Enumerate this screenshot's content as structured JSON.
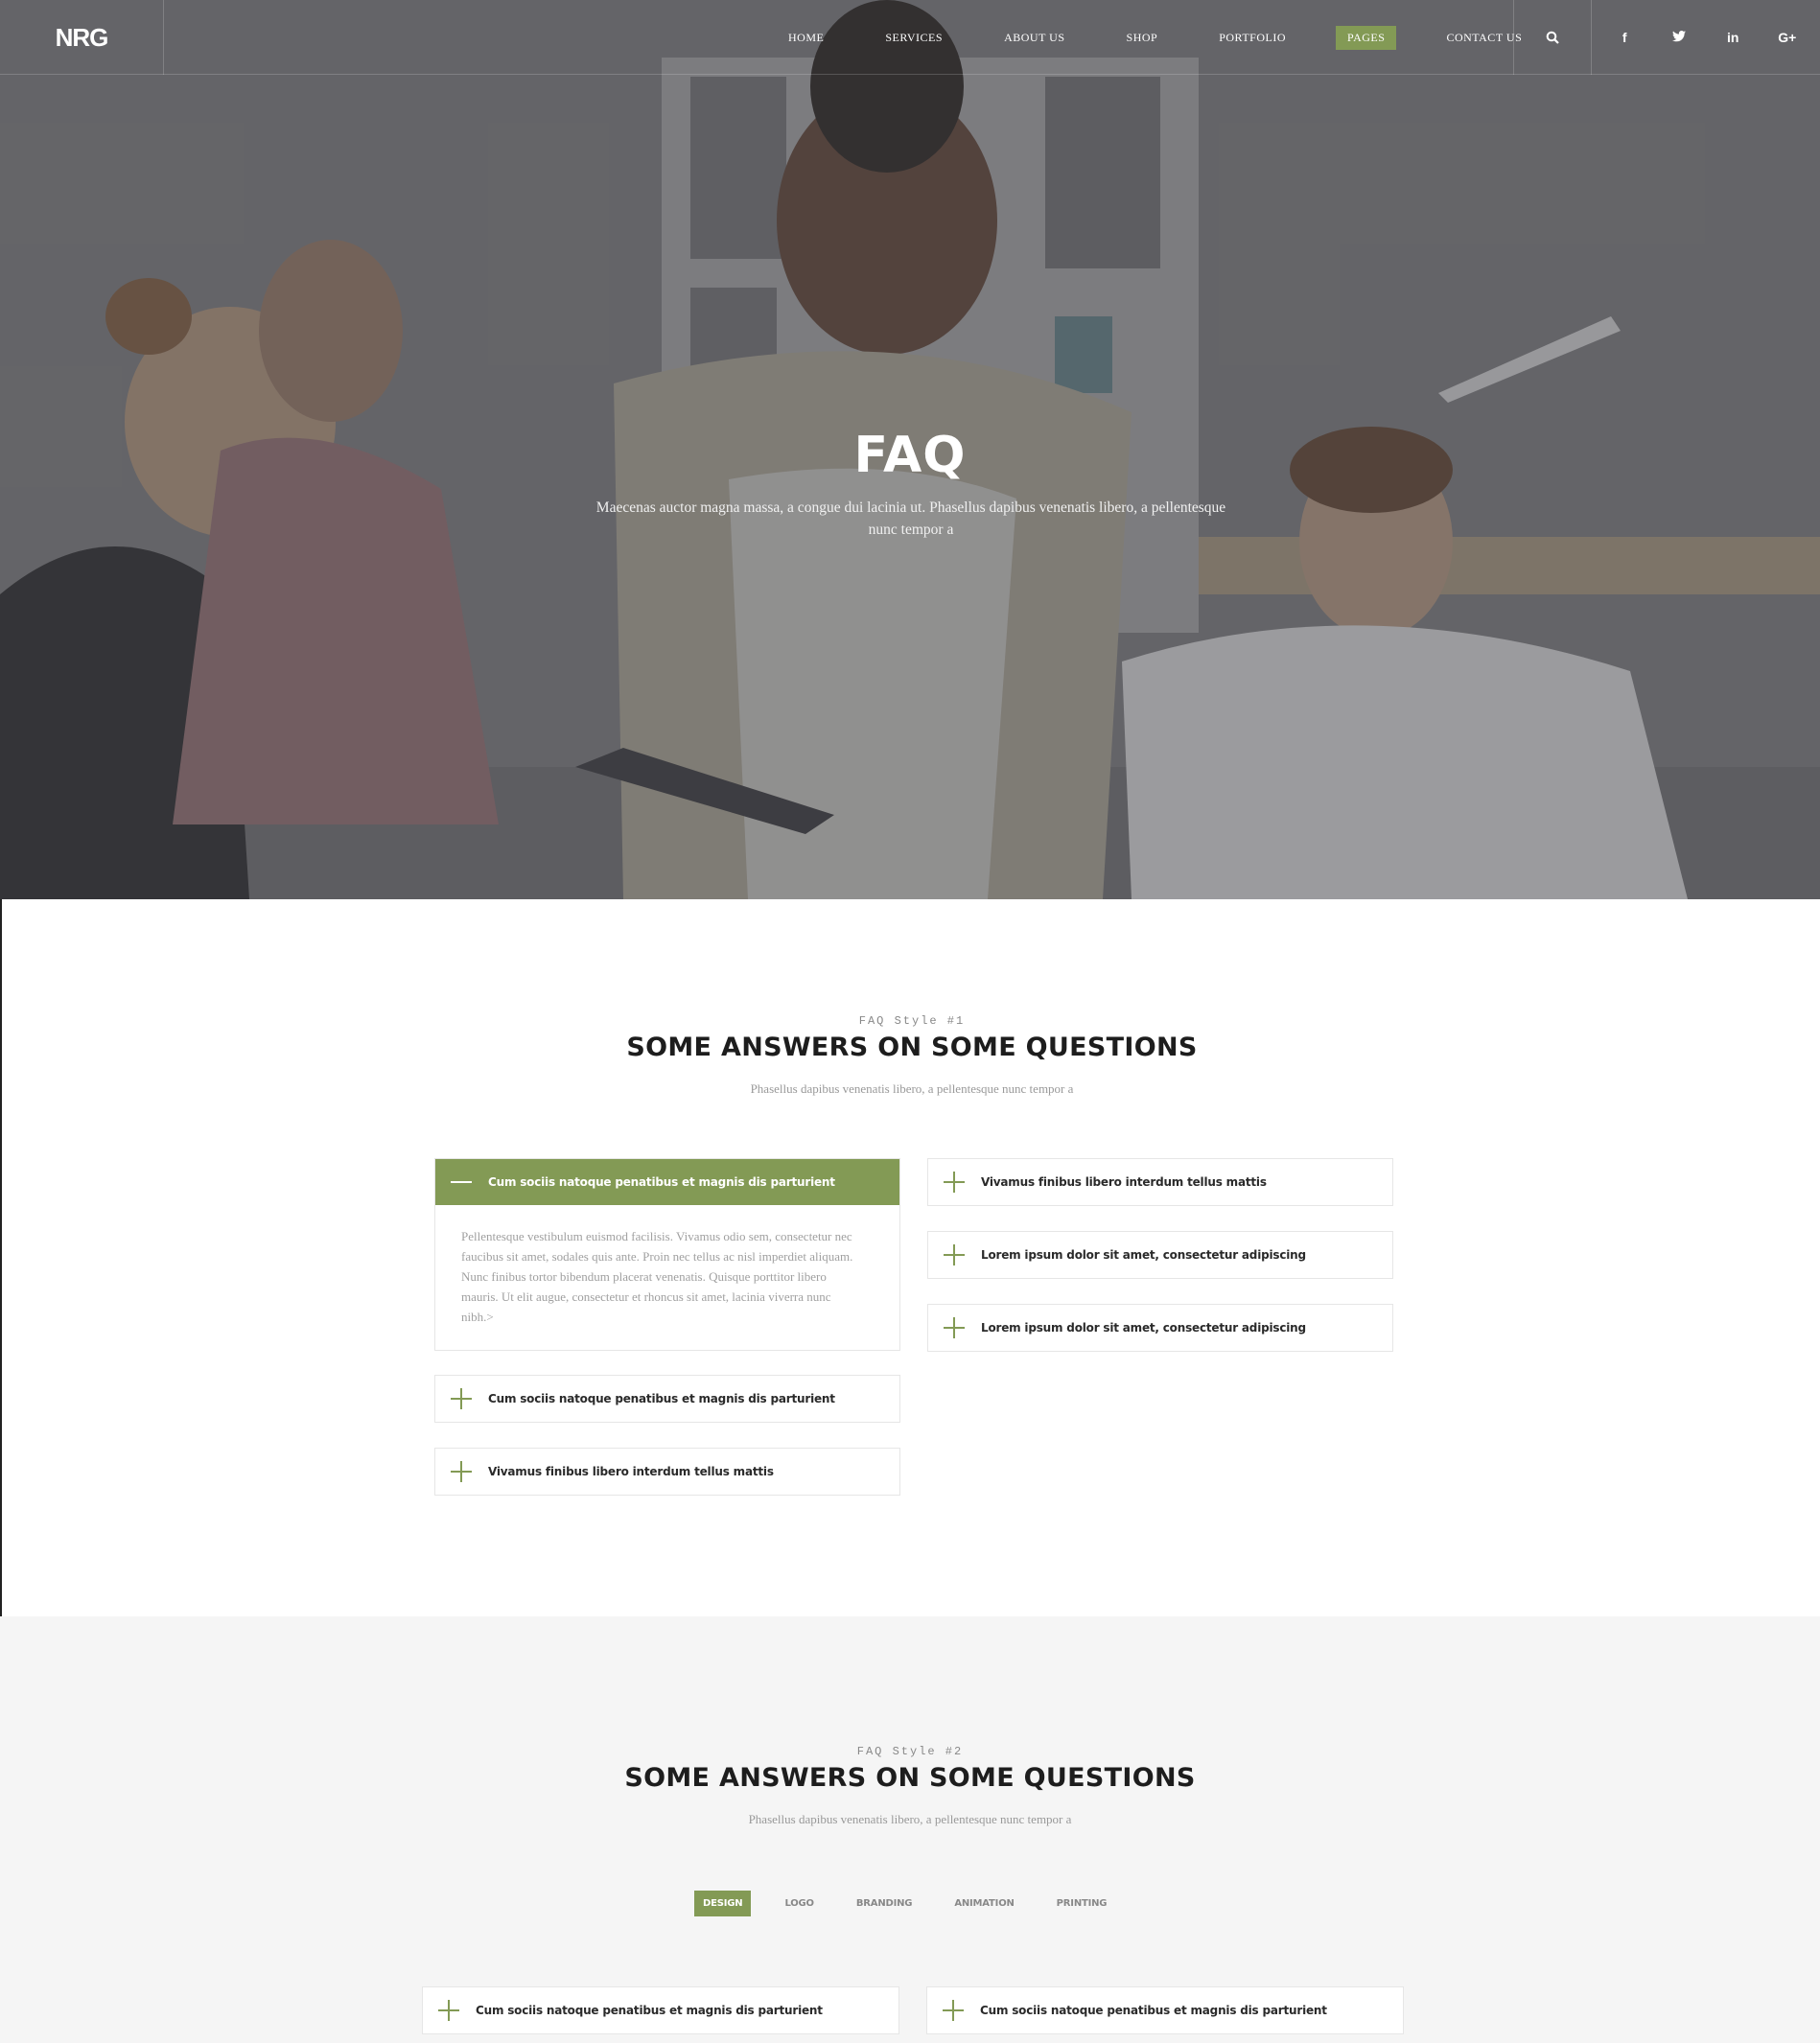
{
  "brand": {
    "logo": "NRG",
    "accent": "#839a55"
  },
  "nav": {
    "items": [
      "HOME",
      "SERVICES",
      "ABOUT US",
      "SHOP",
      "PORTFOLIO",
      "PAGES",
      "CONTACT US"
    ],
    "active": "PAGES"
  },
  "social": {
    "facebook": "f",
    "twitter": "t",
    "linkedin": "in",
    "googleplus": "G+"
  },
  "hero": {
    "title": "FAQ",
    "subtitle": "Maecenas auctor magna massa, a congue dui lacinia ut. Phasellus dapibus venenatis libero, a pellentesque nunc tempor a"
  },
  "faq1": {
    "kicker": "FAQ Style #1",
    "heading": "SOME ANSWERS ON SOME QUESTIONS",
    "sub": "Phasellus dapibus venenatis libero, a pellentesque nunc tempor a",
    "left": [
      {
        "q": "Cum sociis natoque penatibus et magnis dis parturient",
        "open": true,
        "a": "Pellentesque vestibulum euismod facilisis. Vivamus odio sem, consectetur nec faucibus sit amet, sodales quis ante. Proin nec tellus ac nisl imperdiet aliquam. Nunc finibus tortor bibendum placerat venenatis. Quisque porttitor libero mauris. Ut elit augue, consectetur et rhoncus sit amet, lacinia viverra nunc nibh.>"
      },
      {
        "q": "Cum sociis natoque penatibus et magnis dis parturient",
        "open": false
      },
      {
        "q": "Vivamus finibus libero interdum tellus mattis",
        "open": false
      }
    ],
    "right": [
      {
        "q": "Vivamus finibus libero interdum tellus mattis",
        "open": false
      },
      {
        "q": "Lorem ipsum dolor sit amet, consectetur adipiscing",
        "open": false
      },
      {
        "q": "Lorem ipsum dolor sit amet, consectetur adipiscing",
        "open": false
      }
    ]
  },
  "faq2": {
    "kicker": "FAQ Style #2",
    "heading": "SOME ANSWERS ON SOME QUESTIONS",
    "sub": "Phasellus dapibus venenatis libero, a pellentesque nunc tempor a",
    "tabs": [
      "DESIGN",
      "LOGO",
      "BRANDING",
      "ANIMATION",
      "PRINTING"
    ],
    "active_tab": "DESIGN",
    "items": [
      {
        "q": "Cum sociis natoque penatibus et magnis dis parturient"
      },
      {
        "q": "Cum sociis natoque penatibus et magnis dis parturient"
      }
    ]
  }
}
